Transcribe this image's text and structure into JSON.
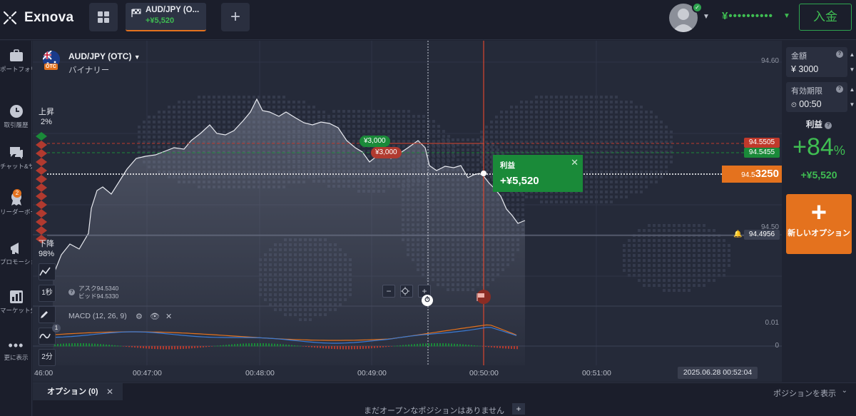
{
  "header": {
    "logo_text": "Exnova",
    "asset_tab": {
      "name": "AUD/JPY (O...",
      "profit": "+¥5,520"
    },
    "balance": "¥••••••••••",
    "deposit_label": "入金"
  },
  "sidebar": {
    "items": [
      {
        "label": "ポートフォリオ",
        "icon": "briefcase-icon"
      },
      {
        "label": "取引履歴",
        "icon": "clock-icon"
      },
      {
        "label": "チャット&サポート",
        "icon": "chat-icon"
      },
      {
        "label": "リーダーボード",
        "icon": "trophy-icon",
        "badge": "2"
      },
      {
        "label": "プロモーション",
        "icon": "megaphone-icon"
      },
      {
        "label": "マーケット分析",
        "icon": "analysis-icon"
      },
      {
        "label": "更に表示",
        "icon": "more-icon"
      }
    ]
  },
  "chart": {
    "asset_name": "AUD/JPY (OTC)",
    "asset_type": "バイナリー",
    "otc_tag": "OTC",
    "up_label": "上昇",
    "up_pct": "2%",
    "down_label": "下降",
    "down_pct": "98%",
    "timeframe_1": "1秒",
    "timeframe_2": "2分",
    "indicator_count": "1",
    "ask": "アスク94.5340",
    "bid": "ビッド94.5330",
    "macd_label": "MACD (12, 26, 9)",
    "price_top": "94.60",
    "price_mid": "94.50",
    "tag_red": "94.5505",
    "tag_green": "94.5455",
    "tag_bell": "94.4956",
    "current_price_small": "94.5",
    "current_price_big": "3250",
    "bet_green": "¥3,000",
    "bet_red": "¥3,000",
    "profit_label": "利益",
    "profit_value": "+¥5,520",
    "macd_axis_top": "0.01",
    "macd_axis_zero": "0",
    "time_labels": [
      "46:00",
      "00:47:00",
      "00:48:00",
      "00:49:00",
      "00:50:00",
      "00:51:00"
    ],
    "time_current": "2025.06.28 00:52:04",
    "colors": {
      "accent": "#e4721e",
      "green": "#1a8a39",
      "red": "#c0392b"
    }
  },
  "right_panel": {
    "amount_label": "金額",
    "amount_value": "¥ 3000",
    "expiry_label": "有効期限",
    "expiry_value": "00:50",
    "profit_title": "利益",
    "profit_pct": "+84",
    "profit_pct_sign": "%",
    "profit_amount": "+¥5,520",
    "new_option_label": "新しいオプション"
  },
  "bottom": {
    "options_tab": "オプション (0)",
    "show_positions": "ポジションを表示",
    "no_positions": "まだオープンなポジションはありません"
  }
}
